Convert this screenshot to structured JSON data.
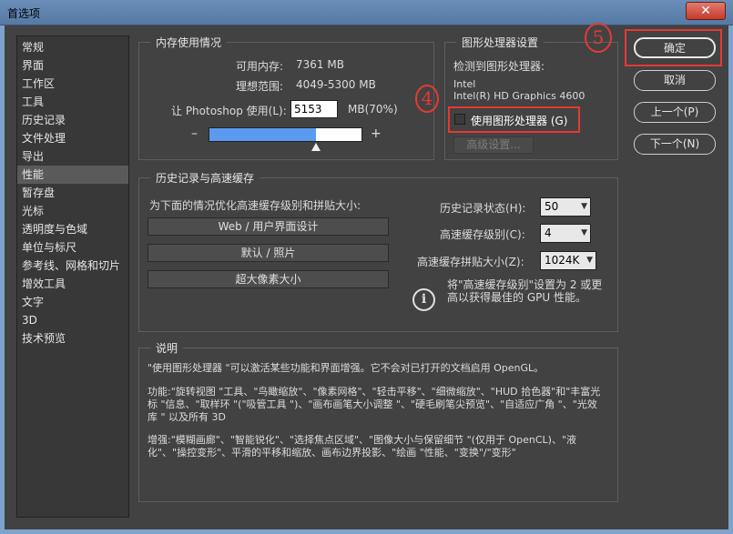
{
  "window": {
    "title": "首选项",
    "close": "✕"
  },
  "sidebar": {
    "items": [
      "常规",
      "界面",
      "工作区",
      "工具",
      "历史记录",
      "文件处理",
      "导出",
      "性能",
      "暂存盘",
      "光标",
      "透明度与色域",
      "单位与标尺",
      "参考线、网格和切片",
      "增效工具",
      "文字",
      "3D",
      "技术预览"
    ],
    "active_index": 7
  },
  "memory": {
    "title": "内存使用情况",
    "available_label": "可用内存:",
    "available_value": "7361 MB",
    "range_label": "理想范围:",
    "range_value": "4049-5300 MB",
    "use_label": "让 Photoshop 使用(L):",
    "use_value": "5153",
    "use_unit": "MB(70%)",
    "minus": "–",
    "plus": "+",
    "slider_percent": 70
  },
  "gpu": {
    "title": "图形处理器设置",
    "detected_label": "检测到图形处理器:",
    "vendor": "Intel",
    "model": "Intel(R) HD Graphics 4600",
    "use_gpu_label": "使用图形处理器 (G)",
    "advanced_label": "高级设置..."
  },
  "history_cache": {
    "title": "历史记录与高速缓存",
    "optimize_label": "为下面的情况优化高速缓存级别和拼贴大小:",
    "preset1": "Web / 用户界面设计",
    "preset2": "默认 / 照片",
    "preset3": "超大像素大小",
    "history_states_label": "历史记录状态(H):",
    "history_states_value": "50",
    "cache_levels_label": "高速缓存级别(C):",
    "cache_levels_value": "4",
    "tile_size_label": "高速缓存拼贴大小(Z):",
    "tile_size_value": "1024K",
    "info_line1": "将\"高速缓存级别\"设置为 2 或更",
    "info_line2": "高以获得最佳的 GPU 性能。"
  },
  "description": {
    "title": "说明",
    "para1": "\"使用图形处理器 \"可以激活某些功能和界面增强。它不会对已打开的文档启用 OpenGL。",
    "para2": "功能:\"旋转视图 \"工具、\"鸟瞰缩放\"、\"像素网格\"、\"轻击平移\"、\"细微缩放\"、\"HUD 拾色器\"和\"丰富光标 \"信息、\"取样环 \"(\"吸管工具 \")、\"画布画笔大小调整 \"、\"硬毛刷笔尖预览\"、\"自适应广角 \"、\"光效库 \" 以及所有 3D",
    "para3": "增强:\"模糊画廊\"、\"智能锐化\"、\"选择焦点区域\"、\"图像大小与保留细节 \"(仅用于 OpenCL)、\"液化\"、\"操控变形\"、平滑的平移和缩放、画布边界投影、\"绘画 \"性能、\"变换\"/\"变形\""
  },
  "buttons": {
    "ok": "确定",
    "cancel": "取消",
    "prev": "上一个(P)",
    "next": "下一个(N)"
  },
  "annotations": {
    "four": "4",
    "five": "5"
  },
  "colors": {
    "slider_fill": "#5b9bef",
    "highlight": "#e53935",
    "titlebar": "#6b8fb8"
  }
}
